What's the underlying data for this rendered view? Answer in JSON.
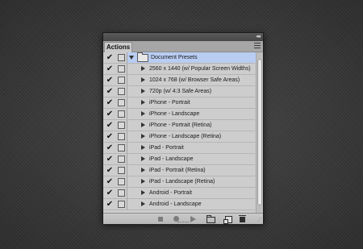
{
  "panel": {
    "tab_label": "Actions",
    "rows": [
      {
        "type": "folder",
        "checked": true,
        "label": "Document Presets",
        "selected": true
      },
      {
        "type": "action",
        "checked": true,
        "label": "2560 x 1440 (w/ Popular Screen Widths)"
      },
      {
        "type": "action",
        "checked": true,
        "label": "1024 x 768 (w/ Browser Safe Areas)"
      },
      {
        "type": "action",
        "checked": true,
        "label": "720p (w/ 4:3 Safe Areas)"
      },
      {
        "type": "action",
        "checked": true,
        "label": "iPhone - Portrait"
      },
      {
        "type": "action",
        "checked": true,
        "label": "iPhone - Landscape"
      },
      {
        "type": "action",
        "checked": true,
        "label": "iPhone - Portrait (Retina)"
      },
      {
        "type": "action",
        "checked": true,
        "label": "iPhone - Landscape (Retina)"
      },
      {
        "type": "action",
        "checked": true,
        "label": "iPad - Portrait"
      },
      {
        "type": "action",
        "checked": true,
        "label": "iPad - Landscape"
      },
      {
        "type": "action",
        "checked": true,
        "label": "iPad - Portrait (Retina)"
      },
      {
        "type": "action",
        "checked": true,
        "label": "iPad - Landscape (Retina)"
      },
      {
        "type": "action",
        "checked": true,
        "label": "Android - Portrait"
      },
      {
        "type": "action",
        "checked": true,
        "label": "Android - Landscape"
      }
    ],
    "checkmark_glyph": "✔",
    "collapse_glyph": "◂◂"
  },
  "toolbar": {
    "icons": [
      "stop-icon",
      "record-icon",
      "play-icon",
      "new-set-icon",
      "new-action-icon",
      "trash-icon"
    ]
  },
  "colors": {
    "selection": "#b9cdf2",
    "panel_bg": "#c8c8c8"
  }
}
